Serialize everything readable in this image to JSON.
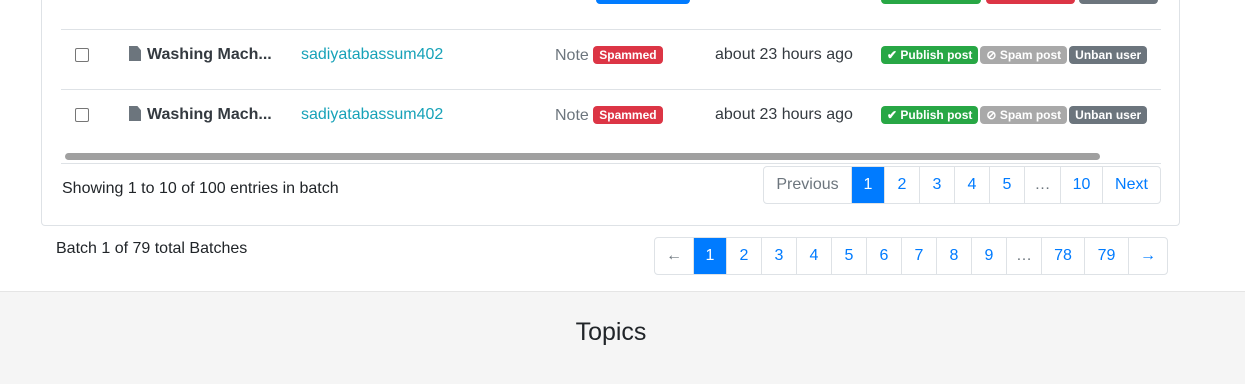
{
  "rows": [
    {
      "title": "Washing Mach...",
      "user": "sadiyatabassum402",
      "type": "Note",
      "status": "Spammed",
      "time": "about 23 hours ago",
      "publish": "Publish post",
      "spam": "Spam post",
      "unban": "Unban user"
    },
    {
      "title": "Washing Mach...",
      "user": "sadiyatabassum402",
      "type": "Note",
      "status": "Spammed",
      "time": "about 23 hours ago",
      "publish": "Publish post",
      "spam": "Spam post",
      "unban": "Unban user"
    }
  ],
  "entries_info": "Showing 1 to 10 of 100 entries in batch",
  "inner_pager": {
    "previous": "Previous",
    "pages": [
      "1",
      "2",
      "3",
      "4",
      "5",
      "…",
      "10"
    ],
    "next": "Next"
  },
  "batch_info": "Batch 1 of 79 total Batches",
  "batch_pager": {
    "prev": "←",
    "pages": [
      "1",
      "2",
      "3",
      "4",
      "5",
      "6",
      "7",
      "8",
      "9",
      "…",
      "78",
      "79"
    ],
    "next": "→"
  },
  "footer": {
    "topics": "Topics"
  },
  "colors": {
    "primary": "#007bff",
    "danger": "#dc3545",
    "success": "#28a745",
    "muted": "#6c757d",
    "link": "#17a2b8"
  }
}
